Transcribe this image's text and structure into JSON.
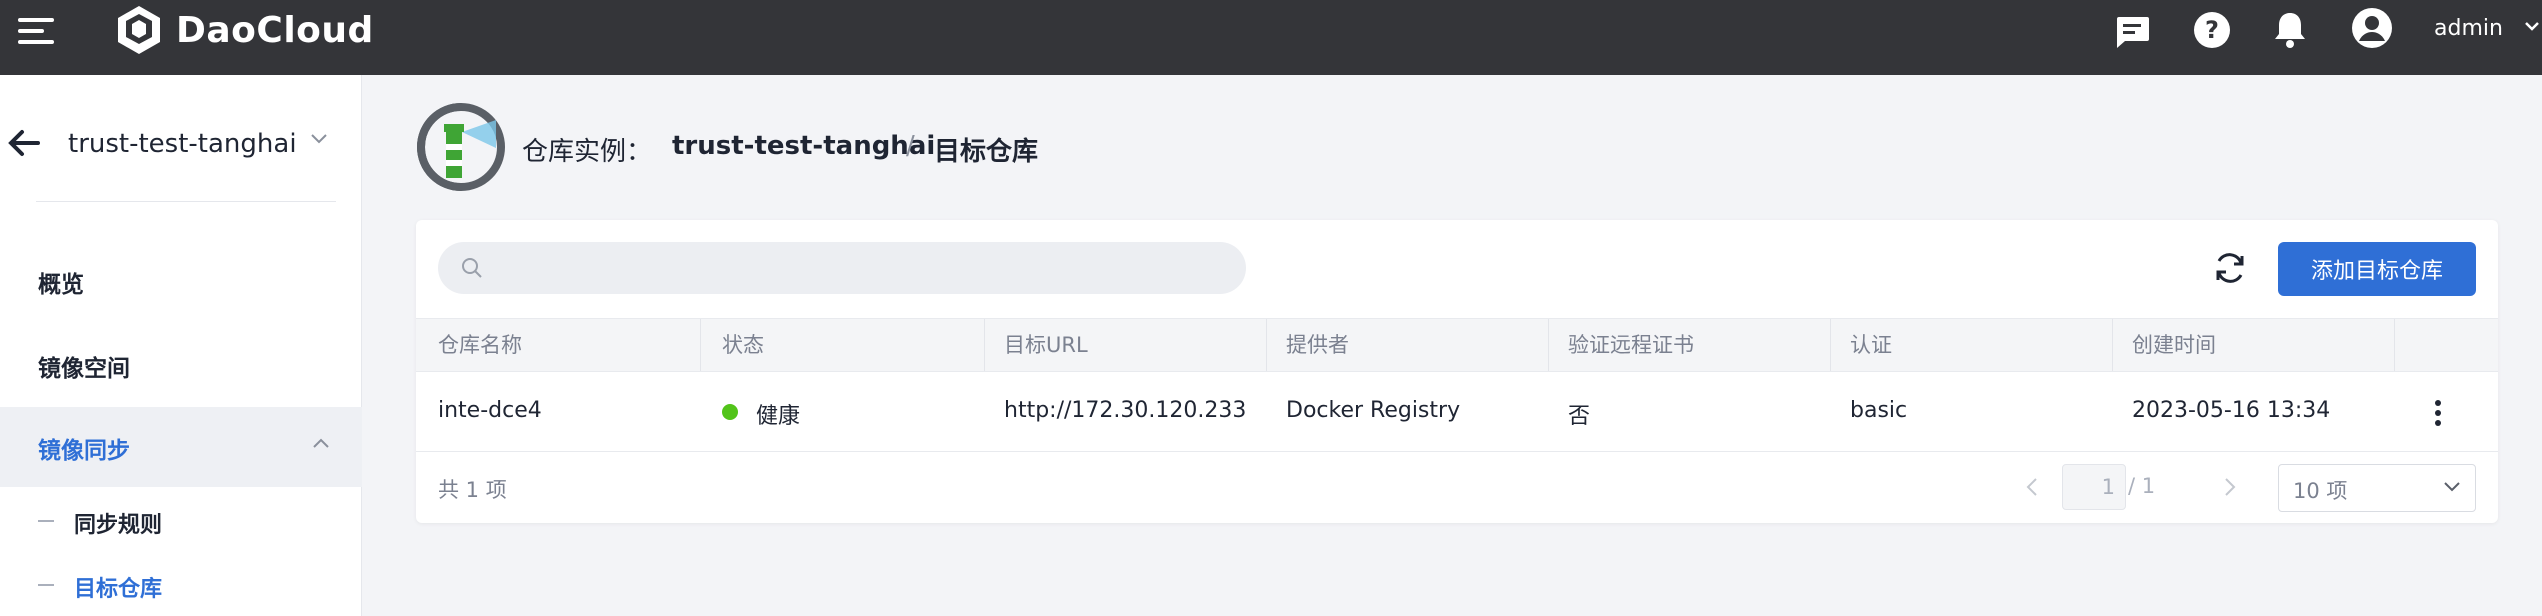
{
  "app": {
    "brand": "DaoCloud",
    "user": "admin"
  },
  "sidebar": {
    "workspace": "trust-test-tanghai",
    "items": [
      {
        "label": "概览"
      },
      {
        "label": "镜像空间"
      },
      {
        "label": "镜像同步"
      }
    ],
    "sub_items": [
      {
        "label": "同步规则"
      },
      {
        "label": "目标仓库"
      }
    ]
  },
  "breadcrumb": {
    "prefix": "仓库实例：",
    "instance": "trust-test-tanghai",
    "separator": "/",
    "current": "目标仓库"
  },
  "toolbar": {
    "search_placeholder": "",
    "add_label": "添加目标仓库"
  },
  "table": {
    "columns": [
      "仓库名称",
      "状态",
      "目标URL",
      "提供者",
      "验证远程证书",
      "认证",
      "创建时间"
    ],
    "rows": [
      {
        "name": "inte-dce4",
        "status": "健康",
        "url": "http://172.30.120.233",
        "provider": "Docker Registry",
        "verify": "否",
        "auth": "basic",
        "created": "2023-05-16 13:34"
      }
    ]
  },
  "pagination": {
    "total": "共 1 项",
    "current": "1",
    "of": "/ 1",
    "page_size": "10 项"
  },
  "colors": {
    "primary": "#2f6fd6",
    "topbar": "#343539",
    "healthy": "#52c41a"
  }
}
